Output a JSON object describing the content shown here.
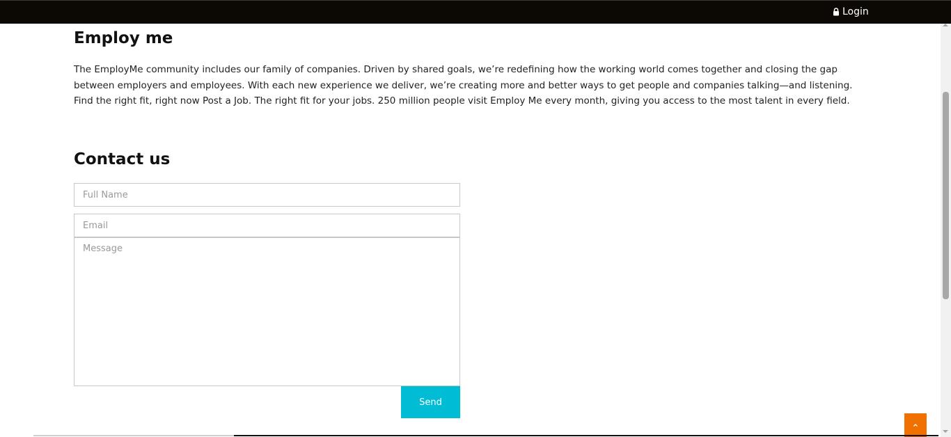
{
  "header": {
    "login_label": "Login",
    "login_icon": "lock-icon",
    "background": "#0c0804"
  },
  "about": {
    "title": "Employ me",
    "text": "The EmployMe community includes our family of companies. Driven by shared goals, we’re redefining how the working world comes together and closing the gap between employers and employees. With each new experience we deliver, we’re creating more and better ways to get people and companies talking—and listening. Find the right fit, right now Post a Job. The right fit for your jobs. 250 million people visit Employ Me every month, giving you access to the most talent in every field."
  },
  "contact": {
    "title": "Contact us",
    "name_placeholder": "Full Name",
    "email_placeholder": "Email",
    "message_placeholder": "Message",
    "send_label": "Send",
    "send_color": "#00bcd4"
  },
  "back_to_top": {
    "icon": "chevron-up-icon",
    "color": "#f07000"
  }
}
